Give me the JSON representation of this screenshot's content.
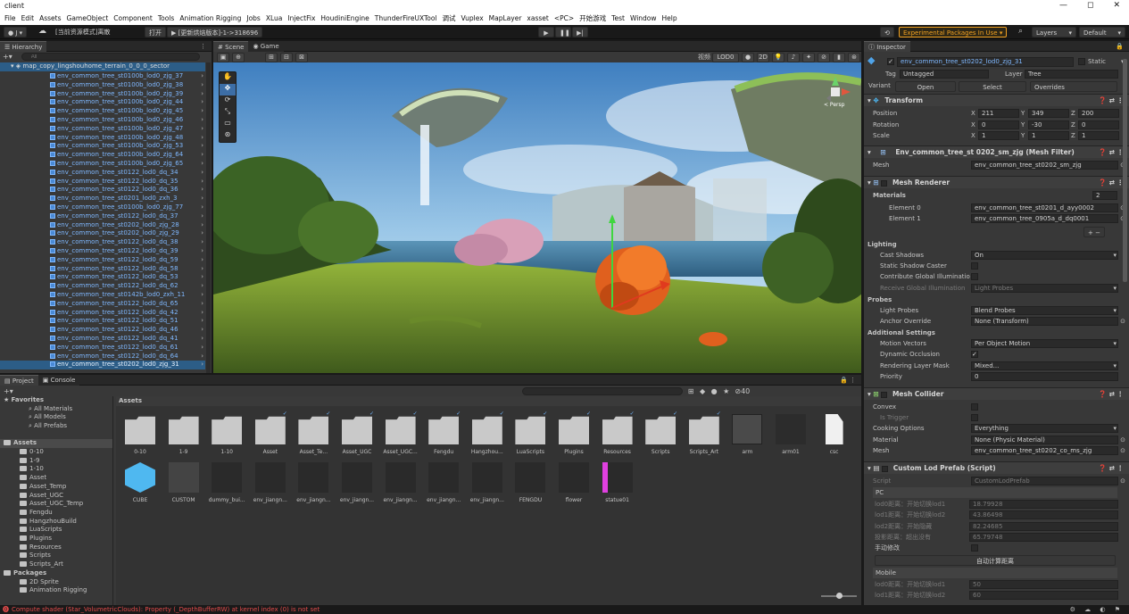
{
  "window": {
    "title": "client",
    "controls": [
      "—",
      "◻",
      "✕"
    ]
  },
  "menu": [
    "File",
    "Edit",
    "Assets",
    "GameObject",
    "Component",
    "Tools",
    "Animation Rigging",
    "Jobs",
    "XLua",
    "InjectFix",
    "HoudiniEngine",
    "ThunderFireUXTool",
    "调试",
    "Vuplex",
    "MapLayer",
    "xasset",
    "<PC>",
    "开始游戏",
    "Test",
    "Window",
    "Help"
  ],
  "toolbar": {
    "account": "J ▾",
    "mode_text": "[当前资源模式]离散",
    "open_btn": "打开",
    "build_btn": "▶ [更新烘焙版本]-1->318696",
    "experimental": "Experimental Packages In Use ▾",
    "layers": "Layers",
    "layout": "Default"
  },
  "hierarchy": {
    "title": "Hierarchy",
    "search_placeholder": "All",
    "root": "map_copy_lingshouhome_terrain_0_0_0_sector",
    "items": [
      "env_common_tree_st0100b_lod0_zjg_37",
      "env_common_tree_st0100b_lod0_zjg_38",
      "env_common_tree_st0100b_lod0_zjg_39",
      "env_common_tree_st0100b_lod0_zjg_44",
      "env_common_tree_st0100b_lod0_zjg_45",
      "env_common_tree_st0100b_lod0_zjg_46",
      "env_common_tree_st0100b_lod0_zjg_47",
      "env_common_tree_st0100b_lod0_zjg_48",
      "env_common_tree_st0100b_lod0_zjg_53",
      "env_common_tree_st0100b_lod0_zjg_64",
      "env_common_tree_st0100b_lod0_zjg_65",
      "env_common_tree_st0122_lod0_dq_34",
      "env_common_tree_st0122_lod0_dq_35",
      "env_common_tree_st0122_lod0_dq_36",
      "env_common_tree_st0201_lod0_zxh_3",
      "env_common_tree_st0100b_lod0_zjg_77",
      "env_common_tree_st0122_lod0_dq_37",
      "env_common_tree_st0202_lod0_zjg_28",
      "env_common_tree_st0202_lod0_zjg_29",
      "env_common_tree_st0122_lod0_dq_38",
      "env_common_tree_st0122_lod0_dq_39",
      "env_common_tree_st0122_lod0_dq_59",
      "env_common_tree_st0122_lod0_dq_58",
      "env_common_tree_st0122_lod0_dq_53",
      "env_common_tree_st0122_lod0_dq_62",
      "env_common_tree_st0142b_lod0_zxh_11",
      "env_common_tree_st0122_lod0_dq_65",
      "env_common_tree_st0122_lod0_dq_42",
      "env_common_tree_st0122_lod0_dq_51",
      "env_common_tree_st0122_lod0_dq_46",
      "env_common_tree_st0122_lod0_dq_41",
      "env_common_tree_st0122_lod0_dq_61",
      "env_common_tree_st0122_lod0_dq_64",
      "env_common_tree_st0202_lod0_zjg_31"
    ]
  },
  "scene": {
    "tabs": [
      "Scene",
      "Game"
    ],
    "lod_label": "LOD0",
    "lod_prefix": "视频",
    "twod": "2D",
    "persp": "< Persp"
  },
  "inspector": {
    "title": "Inspector",
    "object_name": "env_common_tree_st0202_lod0_zjg_31",
    "static_label": "Static",
    "tag_label": "Tag",
    "tag_value": "Untagged",
    "layer_label": "Layer",
    "layer_value": "Tree",
    "variant_label": "Variant",
    "open_btn": "Open",
    "select_btn": "Select",
    "overrides": "Overrides",
    "transform": {
      "title": "Transform",
      "position_label": "Position",
      "pos": [
        "211",
        "349",
        "200"
      ],
      "rotation_label": "Rotation",
      "rot": [
        "0",
        "-30",
        "0"
      ],
      "scale_label": "Scale",
      "scl": [
        "1",
        "1",
        "1"
      ]
    },
    "mesh_filter": {
      "title": "Env_common_tree_st 0202_sm_zjg (Mesh Filter)",
      "mesh_label": "Mesh",
      "mesh": "env_common_tree_st0202_sm_zjg"
    },
    "mesh_renderer": {
      "title": "Mesh Renderer",
      "materials_label": "Materials",
      "materials_count": "2",
      "el0_label": "Element 0",
      "el0": "env_common_tree_st0201_d_ayy0002",
      "el1_label": "Element 1",
      "el1": "env_common_tree_0905a_d_dq0001",
      "lighting": "Lighting",
      "cast_shadows_label": "Cast Shadows",
      "cast_shadows": "On",
      "static_shadow_label": "Static Shadow Caster",
      "contribute_gi_label": "Contribute Global Illuminatio",
      "receive_gi_label": "Receive Global Illumination",
      "receive_gi": "Light Probes",
      "probes": "Probes",
      "light_probes_label": "Light Probes",
      "light_probes": "Blend Probes",
      "anchor_label": "Anchor Override",
      "anchor": "None (Transform)",
      "additional": "Additional Settings",
      "motion_label": "Motion Vectors",
      "motion": "Per Object Motion",
      "dyn_occ_label": "Dynamic Occlusion",
      "render_layer_label": "Rendering Layer Mask",
      "render_layer": "Mixed...",
      "priority_label": "Priority",
      "priority": "0"
    },
    "mesh_collider": {
      "title": "Mesh Collider",
      "convex_label": "Convex",
      "trigger_label": "Is Trigger",
      "cooking_label": "Cooking Options",
      "cooking": "Everything",
      "material_label": "Material",
      "material": "None (Physic Material)",
      "mesh_label": "Mesh",
      "mesh": "env_common_tree_st0202_co_ms_zjg"
    },
    "custom_lod": {
      "title": "Custom Lod Prefab (Script)",
      "script_label": "Script",
      "script": "CustomLodPrefab",
      "pc": "PC",
      "lod0_label": "lod0距离：开始切换lod1",
      "lod0": "18.79928",
      "lod1_label": "lod1距离：开始切换lod2",
      "lod1": "43.86498",
      "lod2_label": "lod2距离：开始隐藏",
      "lod2": "82.24685",
      "shadow_label": "投影距离：超出没有",
      "shadow": "65.79748",
      "manual_label": "手动修改",
      "auto_btn": "自动计算距离",
      "mobile": "Mobile",
      "m_lod0_label": "lod0距离：开始切换lod1",
      "m_lod0": "50",
      "m_lod1_label": "lod1距离：开始切换lod2",
      "m_lod1": "60"
    }
  },
  "project": {
    "tabs": [
      "Project",
      "Console"
    ],
    "count": "40",
    "assets_header": "Assets",
    "favorites": "Favorites",
    "fav_items": [
      "All Materials",
      "All Models",
      "All Prefabs"
    ],
    "assets_root": "Assets",
    "tree": [
      "0-10",
      "1-9",
      "1-10",
      "Asset",
      "Asset_Temp",
      "Asset_UGC",
      "Asset_UGC_Temp",
      "Fengdu",
      "HangzhouBuild",
      "LuaScripts",
      "Plugins",
      "Resources",
      "Scripts",
      "Scripts_Art"
    ],
    "packages": "Packages",
    "pkg_items": [
      "2D Sprite",
      "Animation Rigging"
    ],
    "row1": [
      "0-10",
      "1-9",
      "1-10",
      "Asset",
      "Asset_Te...",
      "Asset_UGC",
      "Asset_UGC...",
      "Fengdu",
      "Hangzhou...",
      "LuaScripts",
      "Plugins",
      "Resources",
      "Scripts",
      "Scripts_Art",
      "arm",
      "arm01",
      "csc"
    ],
    "row2": [
      "CUBE",
      "CUSTOM",
      "dummy_bui...",
      "env_jiangn...",
      "env_jiangn...",
      "env_jiangn...",
      "env_jiangn...",
      "env_jiangn...",
      "env_jiangn...",
      "FENGDU",
      "flower",
      "statue01"
    ]
  },
  "status": {
    "message": "Compute shader (Star_VolumetricClouds): Property (_DepthBufferRW) at kernel index (0) is not set"
  }
}
